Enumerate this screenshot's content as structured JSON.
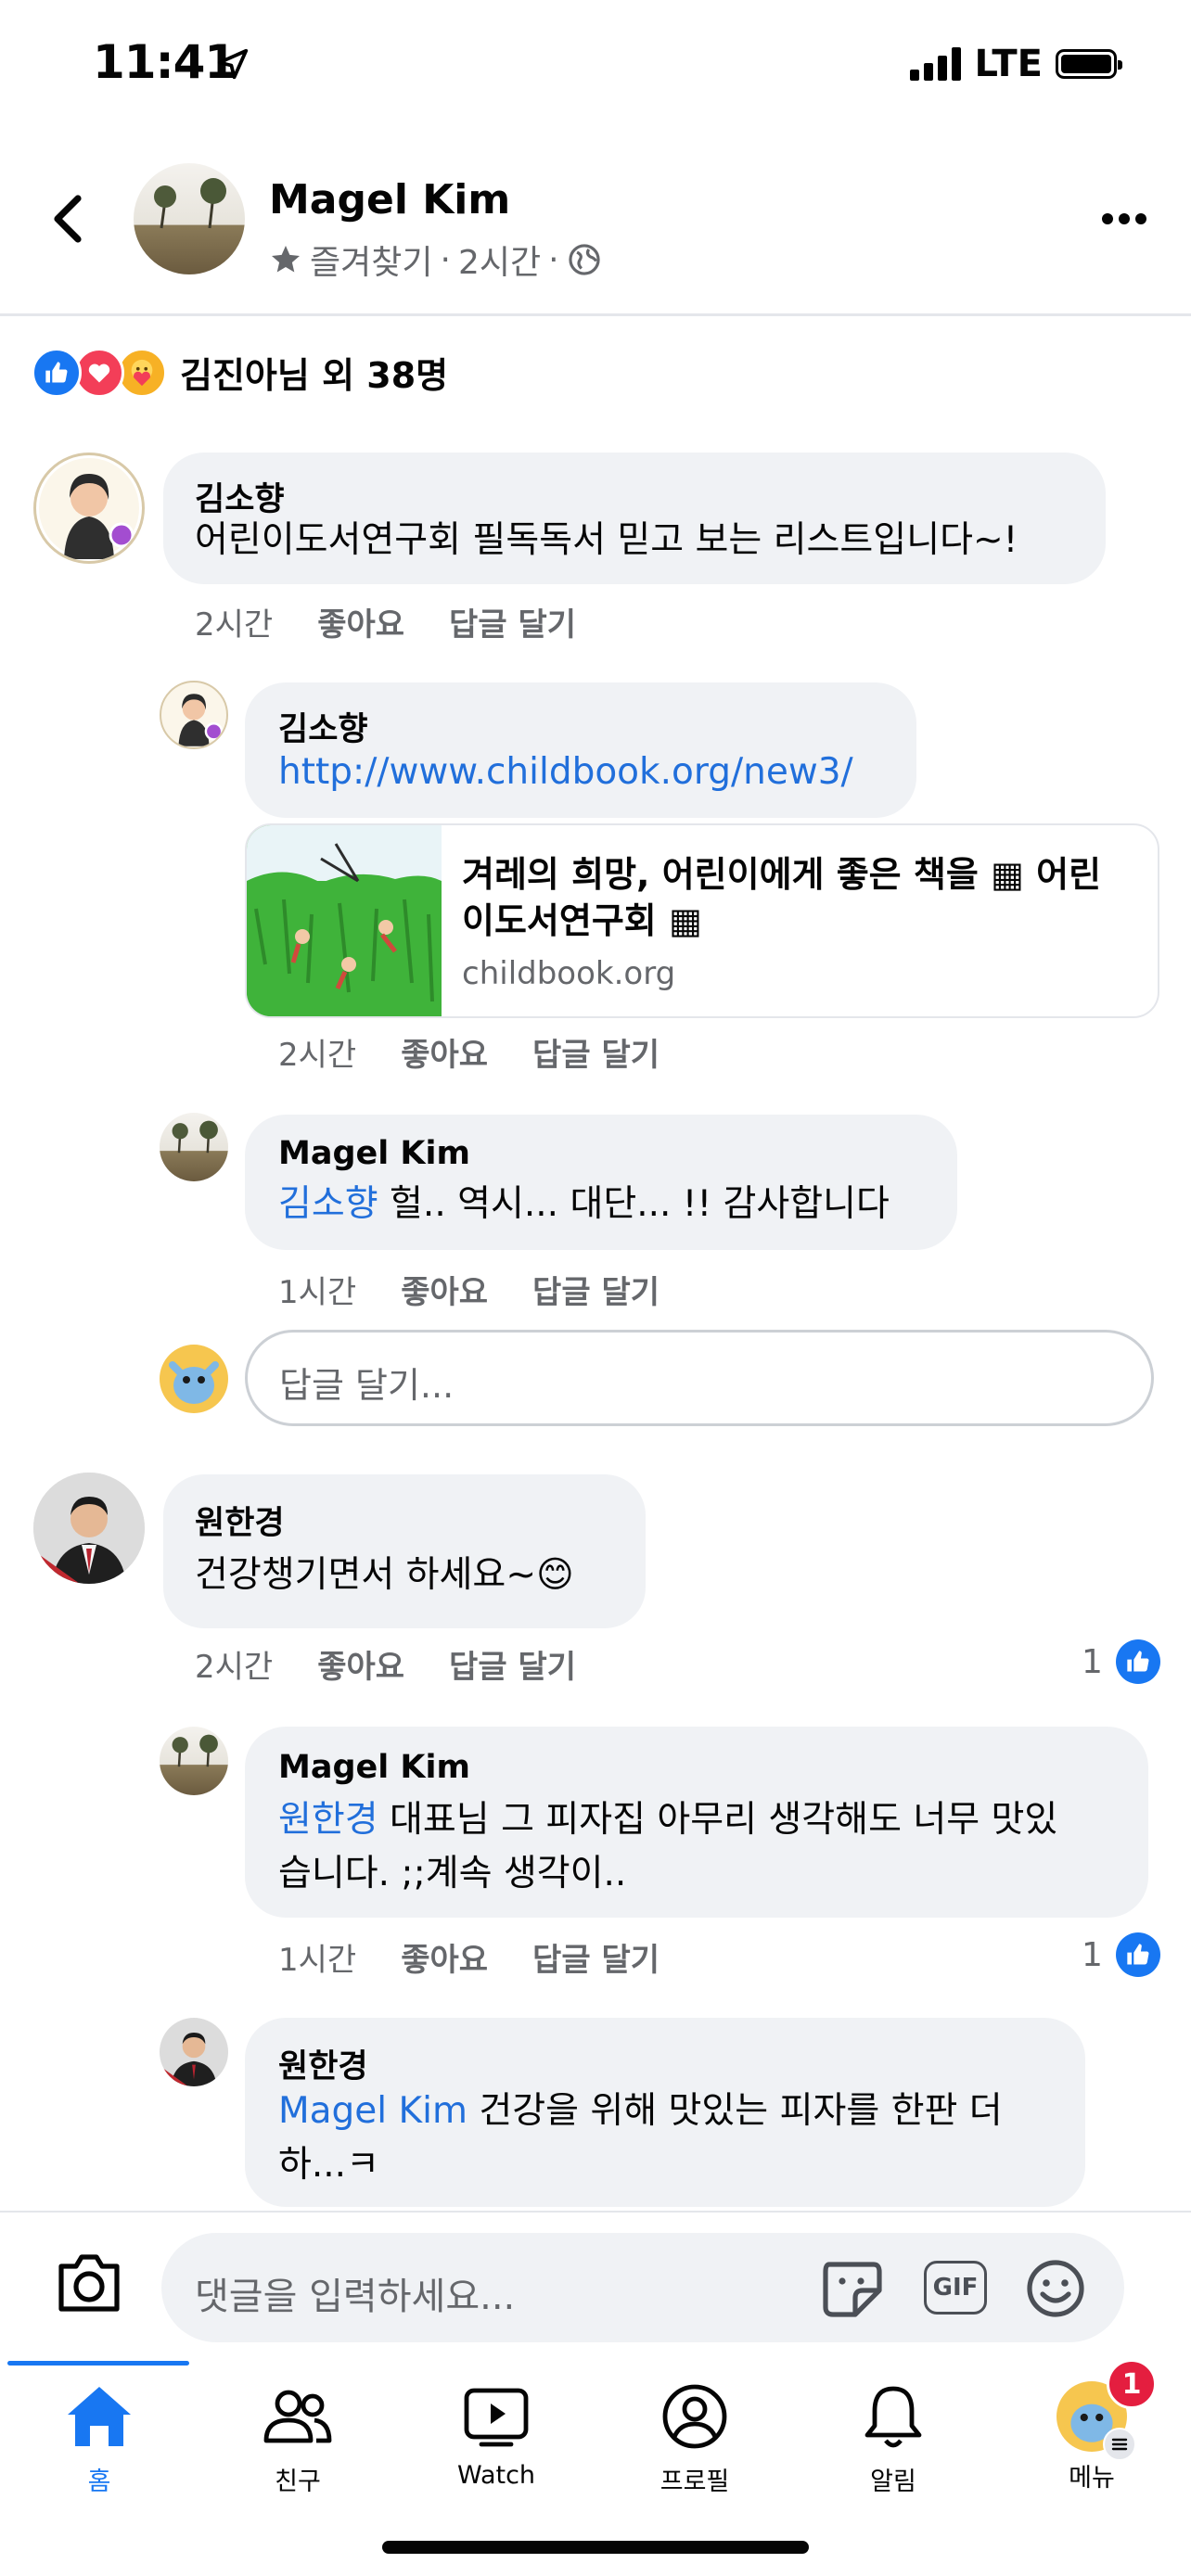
{
  "status": {
    "time": "11:41",
    "network": "LTE"
  },
  "header": {
    "title": "Magel Kim",
    "subtitle_favorite": "즐겨찾기",
    "subtitle_time": "2시간"
  },
  "reactions": {
    "summary": "김진아님 외 38명"
  },
  "comments": [
    {
      "name": "김소향",
      "text": "어린이도서연구회 필독독서 믿고 보는 리스트입니다~!",
      "time": "2시간",
      "like": "좋아요",
      "reply": "답글 달기"
    },
    {
      "name": "김소향",
      "link": "http://www.childbook.org/new3/",
      "preview_title": "겨레의 희망, 어린이에게 좋은 책을 ▦ 어린이도서연구회 ▦",
      "preview_title_line1": "겨레의 희망, 어린이에게 좋은 책을 ▦ 어린",
      "preview_title_line2": "이도서연구회 ▦",
      "preview_domain": "childbook.org",
      "time": "2시간",
      "like": "좋아요",
      "reply": "답글 달기"
    },
    {
      "name": "Magel Kim",
      "mention": "김소향",
      "text": " 헐.. 역시... 대단... !! 감사합니다",
      "time": "1시간",
      "like": "좋아요",
      "reply": "답글 달기"
    },
    {
      "name": "원한경",
      "text": "건강챙기면서 하세요~😊",
      "time": "2시간",
      "like": "좋아요",
      "reply": "답글 달기",
      "like_count": "1"
    },
    {
      "name": "Magel Kim",
      "mention": "원한경",
      "text_line1": " 대표님 그 피자집 아무리 생각해도 너무 맛있",
      "text_line2": "습니다. ;;계속 생각이..",
      "time": "1시간",
      "like": "좋아요",
      "reply": "답글 달기",
      "like_count": "1"
    },
    {
      "name": "원한경",
      "mention": "Magel Kim",
      "text_line1": " 건강을 위해 맛있는 피자를 한판 더",
      "text_line2": "하...ㅋ"
    }
  ],
  "reply_input": {
    "placeholder": "답글 달기..."
  },
  "comment_input": {
    "placeholder": "댓글을 입력하세요...",
    "gif_label": "GIF"
  },
  "tabs": [
    {
      "label": "홈",
      "active": true
    },
    {
      "label": "친구"
    },
    {
      "label": "Watch"
    },
    {
      "label": "프로필"
    },
    {
      "label": "알림"
    },
    {
      "label": "메뉴",
      "badge": "1"
    }
  ],
  "colors": {
    "accent": "#1877f2",
    "mention": "#216fdb",
    "bubble": "#f0f2f5",
    "meta": "#65676b",
    "badge": "#e41e3f"
  }
}
